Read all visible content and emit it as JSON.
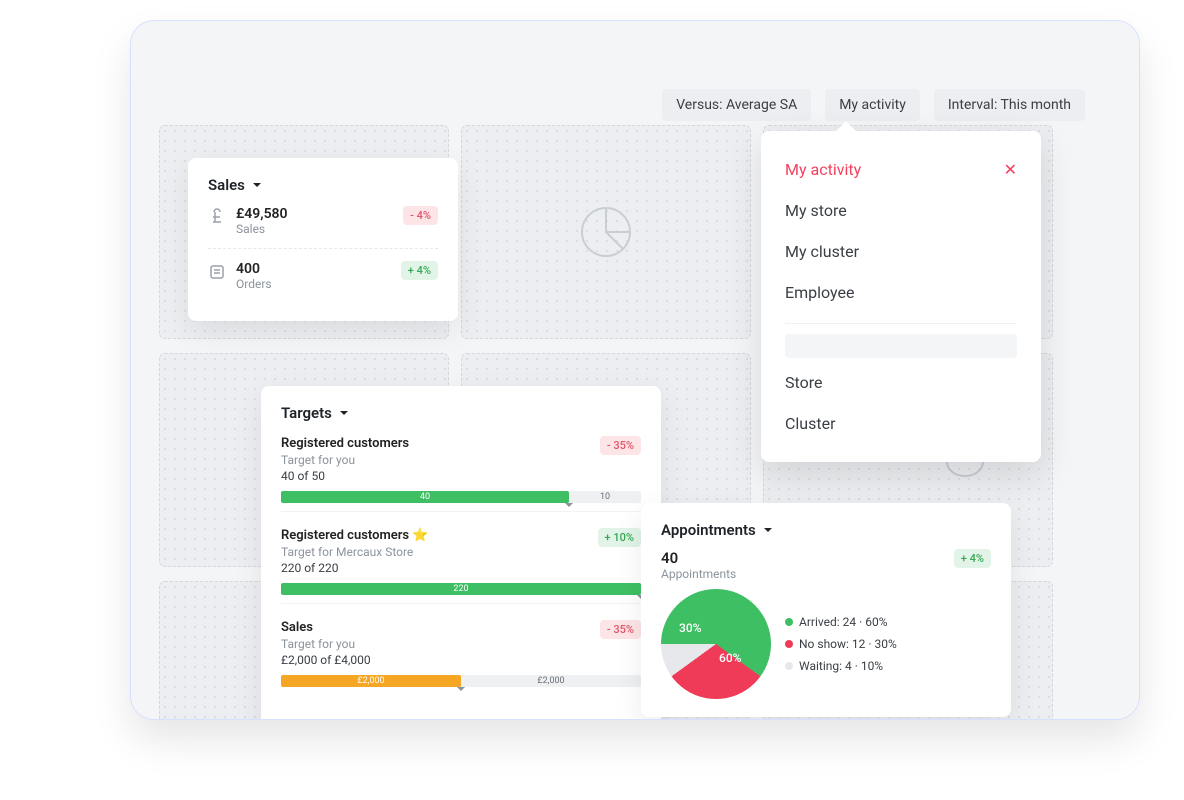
{
  "filters": {
    "versus": "Versus: Average SA",
    "activity": "My activity",
    "interval": "Interval: This month"
  },
  "dropdown": {
    "items": [
      {
        "label": "My activity",
        "active": true
      },
      {
        "label": "My store",
        "active": false
      },
      {
        "label": "My cluster",
        "active": false
      },
      {
        "label": "Employee",
        "active": false
      }
    ],
    "items2": [
      {
        "label": "Store"
      },
      {
        "label": "Cluster"
      }
    ]
  },
  "sales": {
    "title": "Sales",
    "value": "£49,580",
    "value_label": "Sales",
    "value_delta": "- 4%",
    "orders": "400",
    "orders_label": "Orders",
    "orders_delta": "+ 4%"
  },
  "targets": {
    "title": "Targets",
    "items": [
      {
        "title": "Registered customers",
        "subtitle": "Target for you",
        "progress_text": "40 of 50",
        "current": 40,
        "goal": 50,
        "delta": "- 35%",
        "delta_sign": "neg",
        "color": "#3fbf63"
      },
      {
        "title": "Registered customers ⭐",
        "subtitle": "Target for Mercaux Store",
        "progress_text": "220 of 220",
        "current": 220,
        "goal": 220,
        "delta": "+ 10%",
        "delta_sign": "pos",
        "color": "#3fbf63"
      },
      {
        "title": "Sales",
        "subtitle": "Target for you",
        "progress_text": "£2,000 of £4,000",
        "current": 2000,
        "goal": 4000,
        "current_label": "£2,000",
        "rest_label": "£2,000",
        "delta": "- 35%",
        "delta_sign": "neg",
        "color": "#f5a623"
      }
    ]
  },
  "appointments": {
    "title": "Appointments",
    "count": "40",
    "count_label": "Appointments",
    "delta": "+ 4%",
    "legend": [
      {
        "label": "Arrived: 24 · 60%",
        "color": "#3fbf63"
      },
      {
        "label": "No show: 12 · 30%",
        "color": "#ef3b57"
      },
      {
        "label": "Waiting: 4 · 10%",
        "color": "#e6e8eb"
      }
    ]
  },
  "chart_data": {
    "type": "pie",
    "title": "Appointments",
    "series": [
      {
        "name": "Arrived",
        "value": 24,
        "pct": 60,
        "color": "#3fbf63"
      },
      {
        "name": "No show",
        "value": 12,
        "pct": 30,
        "color": "#ef3b57"
      },
      {
        "name": "Waiting",
        "value": 4,
        "pct": 10,
        "color": "#e6e8eb"
      }
    ],
    "total": 40
  }
}
